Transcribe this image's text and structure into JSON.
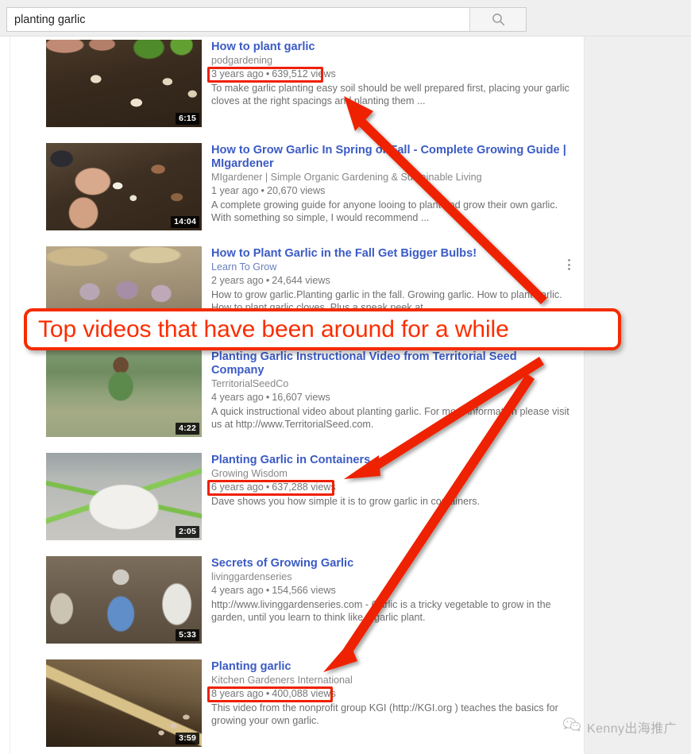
{
  "search": {
    "value": "planting garlic",
    "placeholder": "Search",
    "icon": "search-icon",
    "button_label": ""
  },
  "annotation": {
    "banner_text": "Top videos that have been around for a while",
    "accent_color": "#f42b00",
    "banner_text_color": "#fb2d00"
  },
  "watermark": {
    "text": "Kenny出海推广",
    "icon": "wechat-icon"
  },
  "results": [
    {
      "title": "How to plant garlic",
      "channel": "podgardening",
      "age": "3 years ago",
      "separator": "•",
      "views": "639,512 views",
      "description": "To make garlic planting easy soil should be well prepared first, placing your garlic cloves at the right spacings and planting them ...",
      "duration": "6:15",
      "highlighted": true,
      "kebab": false
    },
    {
      "title": "How to Grow Garlic In Spring or Fall - Complete Growing Guide | MIgardener",
      "channel": "MIgardener | Simple Organic Gardening & Sustainable Living",
      "age": "1 year ago",
      "separator": "•",
      "views": "20,670 views",
      "description": "A complete growing guide for anyone looing to plant and grow their own garlic. With something so simple, I would recommend ...",
      "duration": "14:04",
      "highlighted": false,
      "kebab": false
    },
    {
      "title": "How to Plant Garlic in the Fall Get Bigger Bulbs!",
      "channel": "Learn To Grow",
      "age": "2 years ago",
      "separator": "•",
      "views": "24,644 views",
      "description": "How to grow garlic.Planting garlic in the fall. Growing garlic. How to plant garlic. How to plant garlic cloves. Plus a sneak peek at",
      "duration": "",
      "highlighted": false,
      "kebab": true
    },
    {
      "title": "Planting Garlic Instructional Video from Territorial Seed Company",
      "channel": "TerritorialSeedCo",
      "age": "4 years ago",
      "separator": "•",
      "views": "16,607 views",
      "description": "A quick instructional video about planting garlic. For more information please visit us at http://www.TerritorialSeed.com.",
      "duration": "4:22",
      "highlighted": false,
      "kebab": false
    },
    {
      "title": "Planting Garlic in Containers",
      "channel": "Growing Wisdom",
      "age": "6 years ago",
      "separator": "•",
      "views": "637,288 views",
      "description": "Dave shows you how simple it is to grow garlic in containers.",
      "duration": "2:05",
      "highlighted": true,
      "kebab": false
    },
    {
      "title": "Secrets of Growing Garlic",
      "channel": "livinggardenseries",
      "age": "4 years ago",
      "separator": "•",
      "views": "154,566 views",
      "description": "http://www.livinggardenseries.com - Garlic is a tricky vegetable to grow in the garden, until you learn to think like a garlic plant.",
      "duration": "5:33",
      "highlighted": false,
      "kebab": false
    },
    {
      "title": "Planting garlic",
      "channel": "Kitchen Gardeners International",
      "age": "8 years ago",
      "separator": "•",
      "views": "400,088 views",
      "description": "This video from the nonprofit group KGI (http://KGI.org ) teaches the basics for growing your own garlic.",
      "duration": "3:59",
      "highlighted": true,
      "kebab": false
    }
  ]
}
